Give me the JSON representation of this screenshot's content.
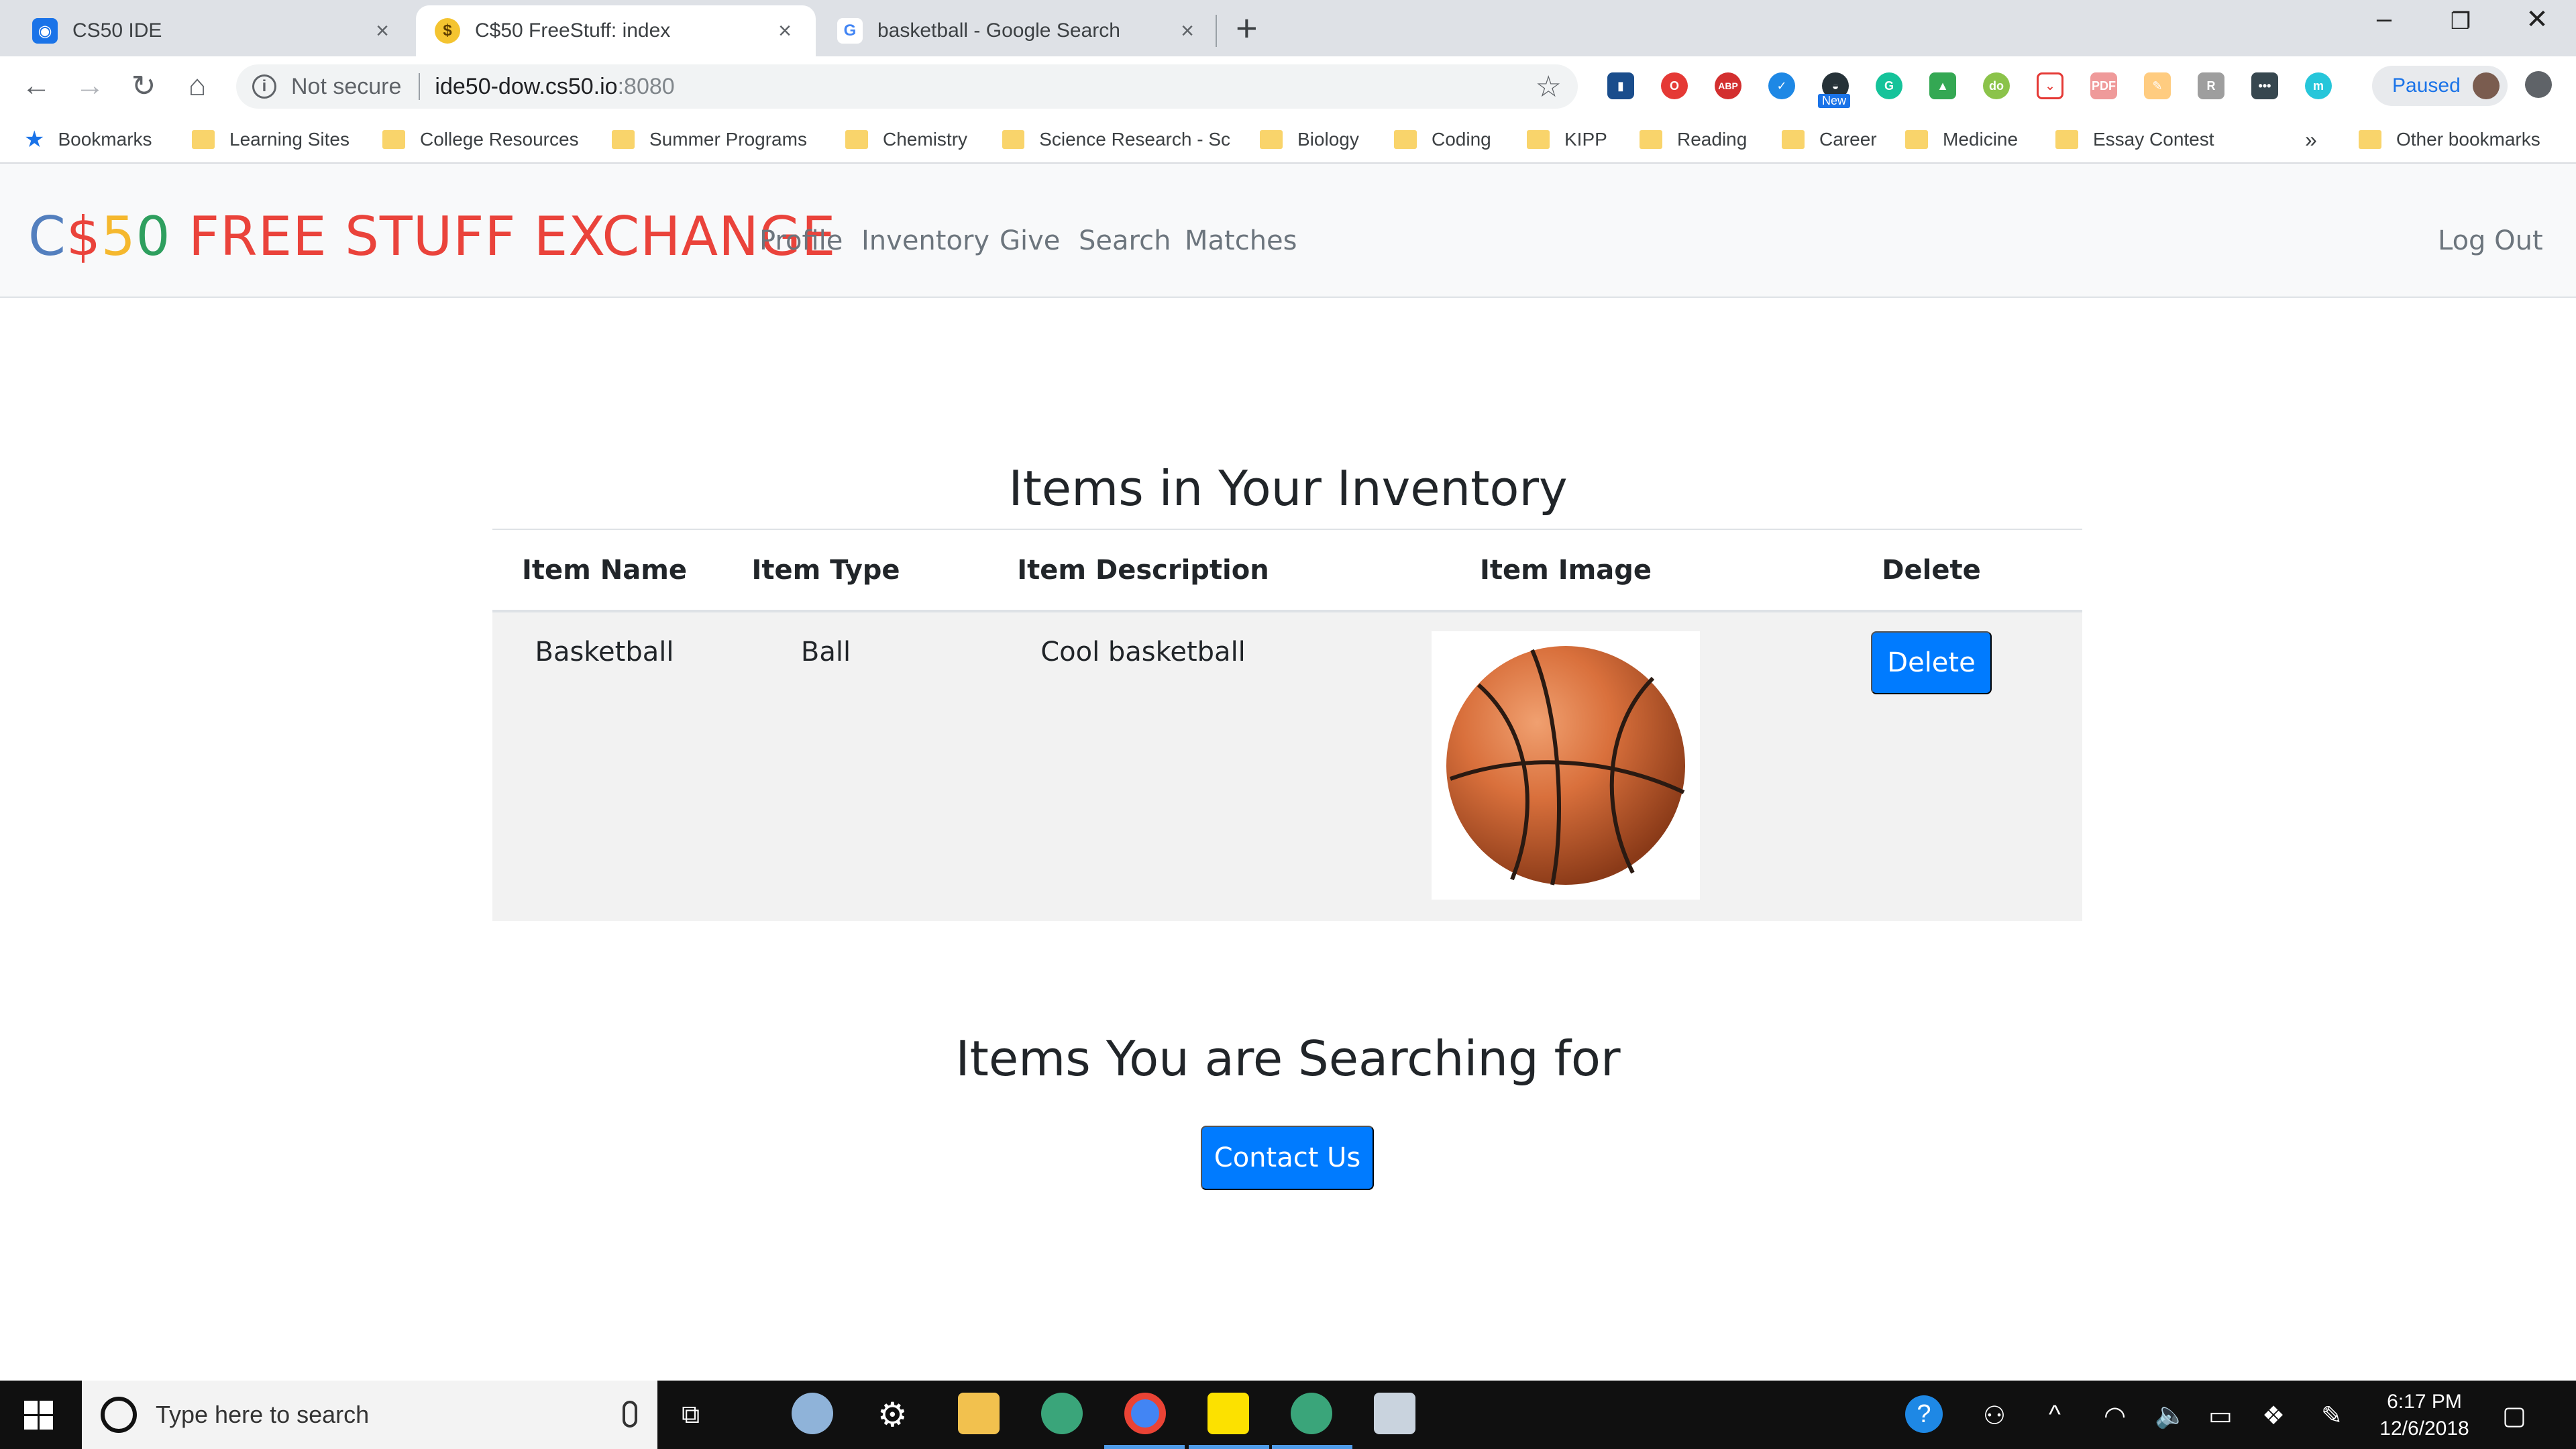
{
  "browser": {
    "tabs": [
      {
        "title": "CS50 IDE",
        "icon": "cs50-ide-icon",
        "active": false
      },
      {
        "title": "C$50 FreeStuff: index",
        "icon": "money-mouth-emoji-icon",
        "active": true
      },
      {
        "title": "basketball - Google Search",
        "icon": "google-icon",
        "active": false
      }
    ],
    "new_tab_label": "+",
    "address": {
      "security_label": "Not secure",
      "host": "ide50-dow.cs50.io",
      "port": ":8080"
    },
    "profile_label": "Paused",
    "extension_badge": "New",
    "bookmarks": [
      "Bookmarks",
      "Learning Sites",
      "College Resources",
      "Summer Programs",
      "Chemistry",
      "Science Research - Sc",
      "Biology",
      "Coding",
      "KIPP",
      "Reading",
      "Career",
      "Medicine",
      "Essay Contest"
    ],
    "bookmarks_overflow": "»",
    "other_bookmarks": "Other bookmarks"
  },
  "site": {
    "brand": {
      "part1": "C",
      "part2": "$",
      "part3": "5",
      "part4": "0",
      "part5": " FREE STUFF EXCHANGE"
    },
    "nav": [
      "Profile",
      "Inventory",
      "Give",
      "Search",
      "Matches"
    ],
    "logout": "Log Out"
  },
  "inventory": {
    "heading": "Items in Your Inventory",
    "columns": [
      "Item Name",
      "Item Type",
      "Item Description",
      "Item Image",
      "Delete"
    ],
    "rows": [
      {
        "name": "Basketball",
        "type": "Ball",
        "description": "Cool basketball",
        "delete_label": "Delete"
      }
    ]
  },
  "searching": {
    "heading": "Items You are Searching for",
    "contact_label": "Contact Us"
  },
  "taskbar": {
    "search_placeholder": "Type here to search",
    "time": "6:17 PM",
    "date": "12/6/2018"
  },
  "colors": {
    "primary_button": "#007bff",
    "brand_red": "#ea433b",
    "brand_blue": "#537fbe",
    "brand_yellow": "#f5b82e",
    "brand_green": "#2e9f5e"
  }
}
